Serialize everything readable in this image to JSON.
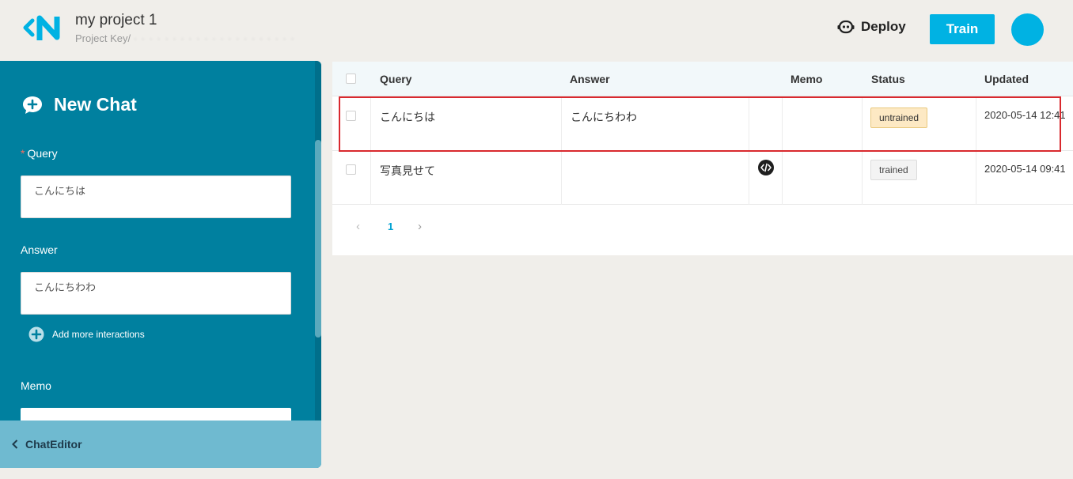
{
  "header": {
    "project_title": "my project 1",
    "project_key_prefix": "Project Key/",
    "project_key_masked": "· · · ·  · · ·  · · · · · · · · · · · · · ·",
    "deploy_label": "Deploy",
    "train_label": "Train"
  },
  "panel": {
    "title": "New Chat",
    "query_required_mark": "*",
    "query_label": "Query",
    "query_value": "こんにちは",
    "answer_label": "Answer",
    "answer_value": "こんにちわわ",
    "add_more_label": "Add more interactions",
    "memo_label": "Memo",
    "footer_label": "ChatEditor"
  },
  "table": {
    "columns": [
      "Query",
      "Answer",
      "Memo",
      "Status",
      "Updated"
    ],
    "rows": [
      {
        "query": "こんにちは",
        "answer": "こんにちわわ",
        "memo": "",
        "status": "untrained",
        "updated": "2020-05-14 12:41"
      },
      {
        "query": "写真見せて",
        "answer": "",
        "memo": "",
        "status": "trained",
        "updated": "2020-05-14 09:41"
      }
    ]
  },
  "pagination": {
    "prev": "‹",
    "current": "1",
    "next": "›"
  },
  "colors": {
    "accent": "#00b2e3",
    "panel": "#00809f",
    "highlight": "#d9292e"
  }
}
